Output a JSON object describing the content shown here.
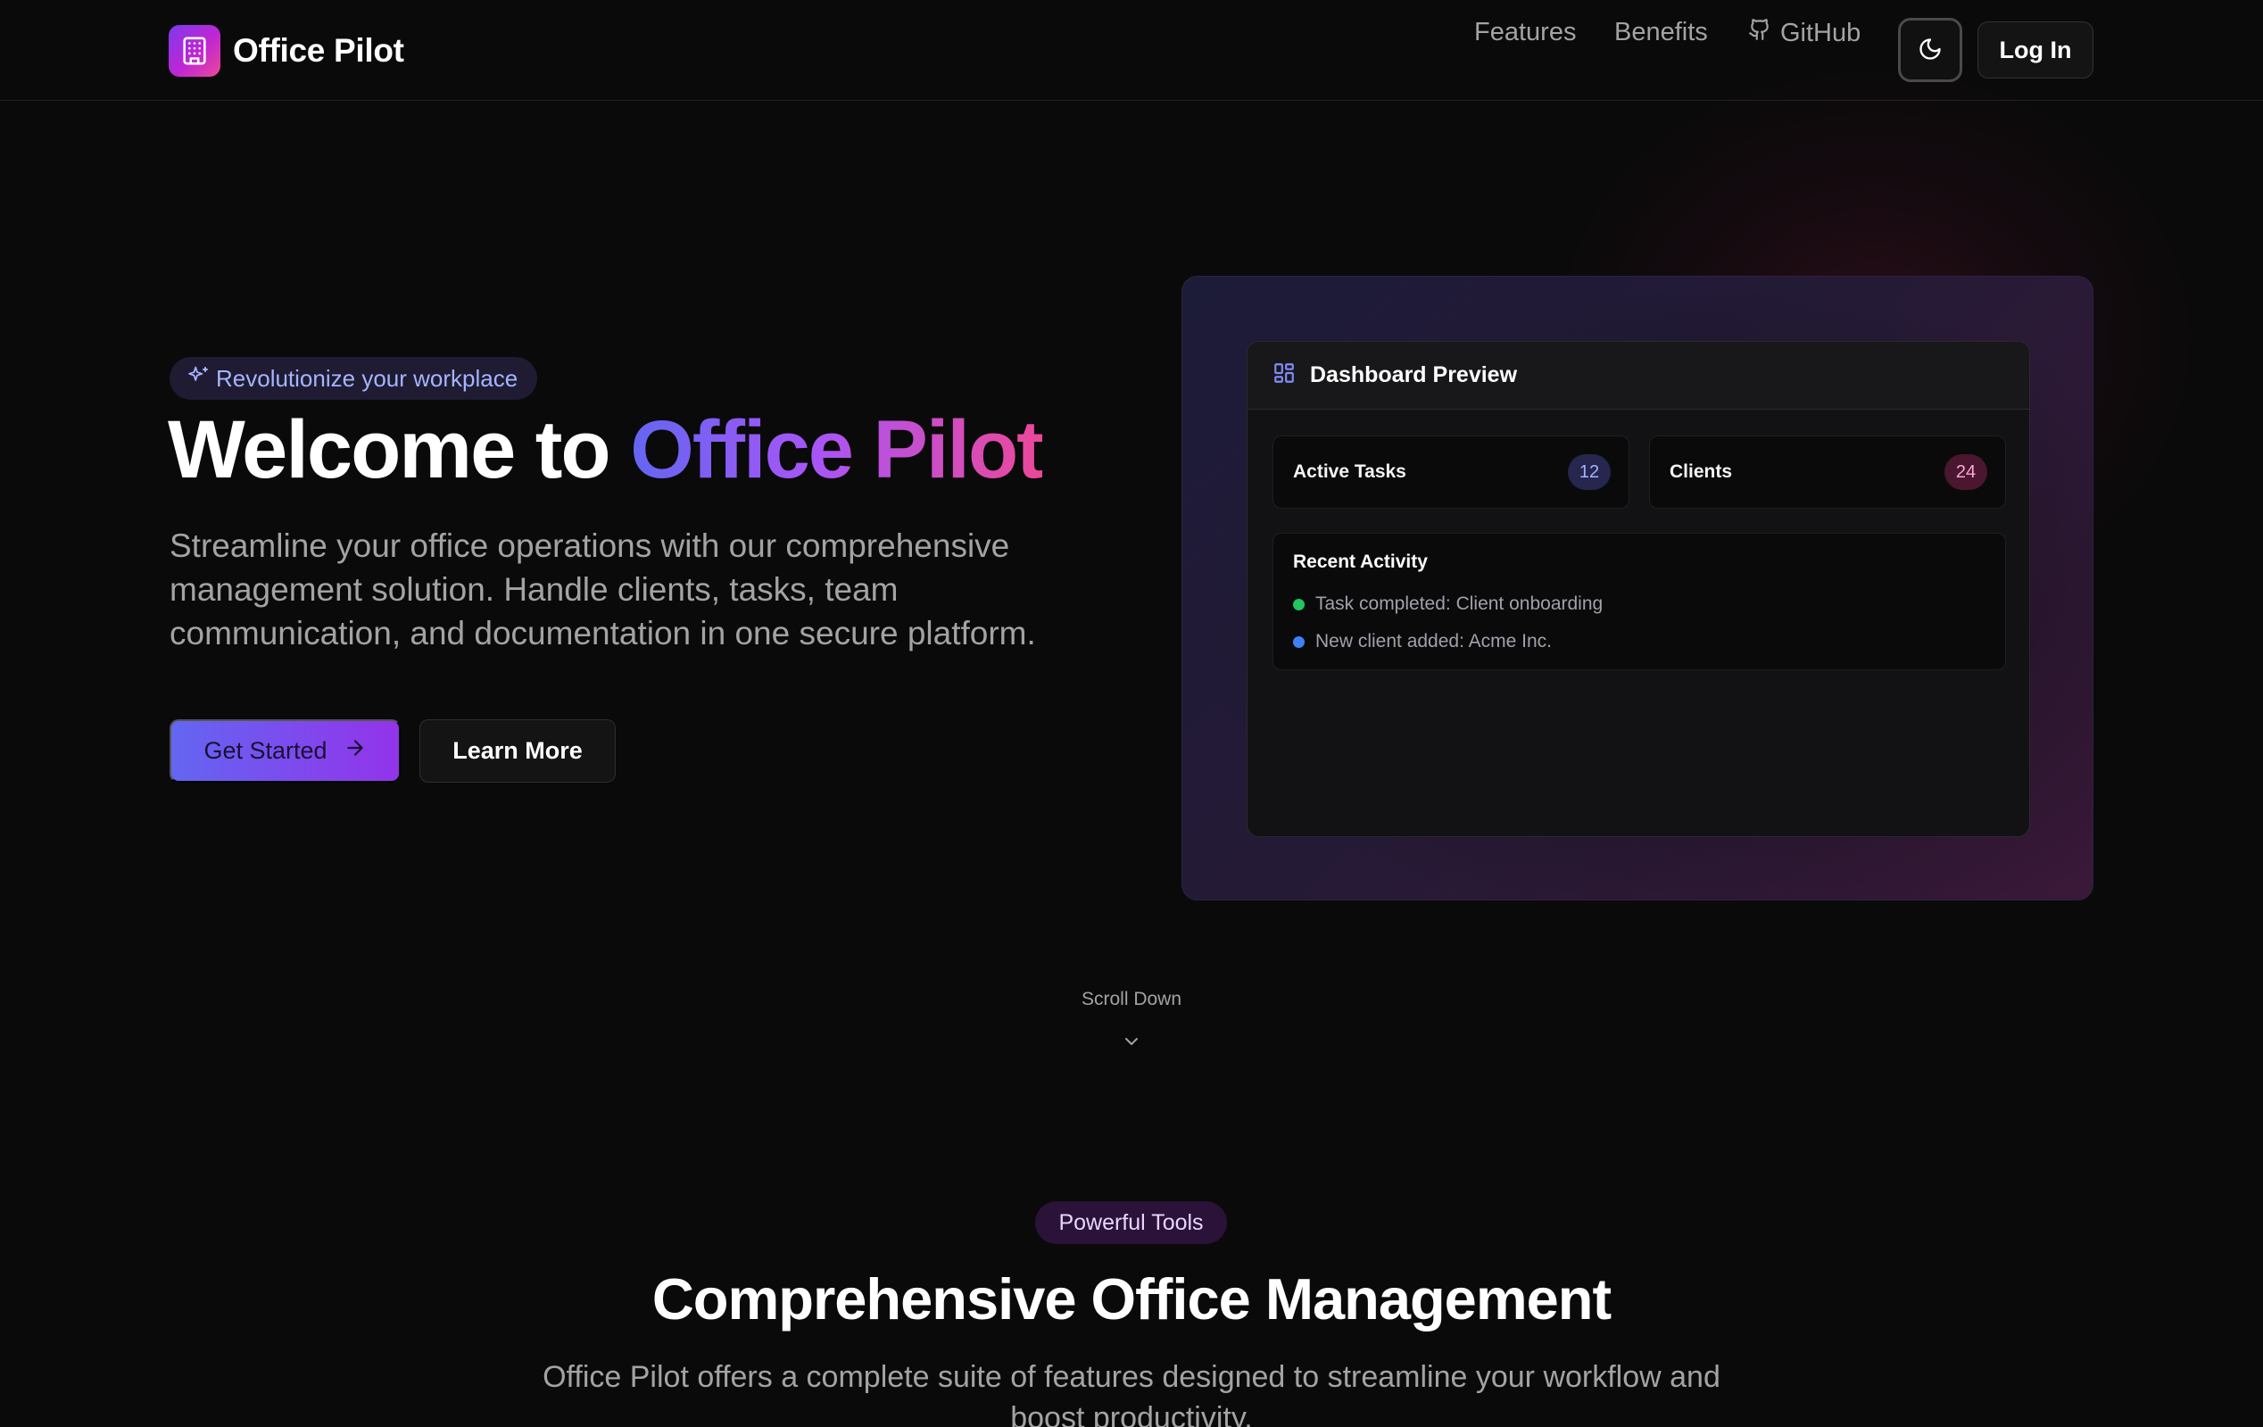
{
  "header": {
    "brand": "Office Pilot",
    "nav": {
      "features": "Features",
      "benefits": "Benefits",
      "github": "GitHub"
    },
    "login_label": "Log In"
  },
  "hero": {
    "badge": "Revolutionize your workplace",
    "title_plain": "Welcome to ",
    "title_highlight": "Office Pilot",
    "description": "Streamline your office operations with our comprehensive management solution. Handle clients, tasks, team communication, and documentation in one secure platform.",
    "primary_cta": "Get Started",
    "secondary_cta": "Learn More"
  },
  "preview": {
    "title": "Dashboard Preview",
    "stats": [
      {
        "label": "Active Tasks",
        "value": "12"
      },
      {
        "label": "Clients",
        "value": "24"
      }
    ],
    "activity_title": "Recent Activity",
    "activity": [
      {
        "text": "Task completed: Client onboarding",
        "status_color": "#22c55e"
      },
      {
        "text": "New client added: Acme Inc.",
        "status_color": "#3b82f6"
      }
    ]
  },
  "scroll_label": "Scroll Down",
  "features_section": {
    "badge": "Powerful Tools",
    "title": "Comprehensive Office Management",
    "description": "Office Pilot offers a complete suite of features designed to streamline your workflow and boost productivity."
  },
  "colors": {
    "accent_start": "#6366f1",
    "accent_mid": "#a855f7",
    "accent_end": "#ec4899",
    "background": "#0a0a0a"
  },
  "icons": {
    "logo": "building-icon",
    "github": "github-icon",
    "theme": "moon-icon",
    "badge": "sparkles-icon",
    "cta": "arrow-right-icon",
    "dashboard": "layout-dashboard-icon",
    "scroll": "chevron-down-icon"
  }
}
